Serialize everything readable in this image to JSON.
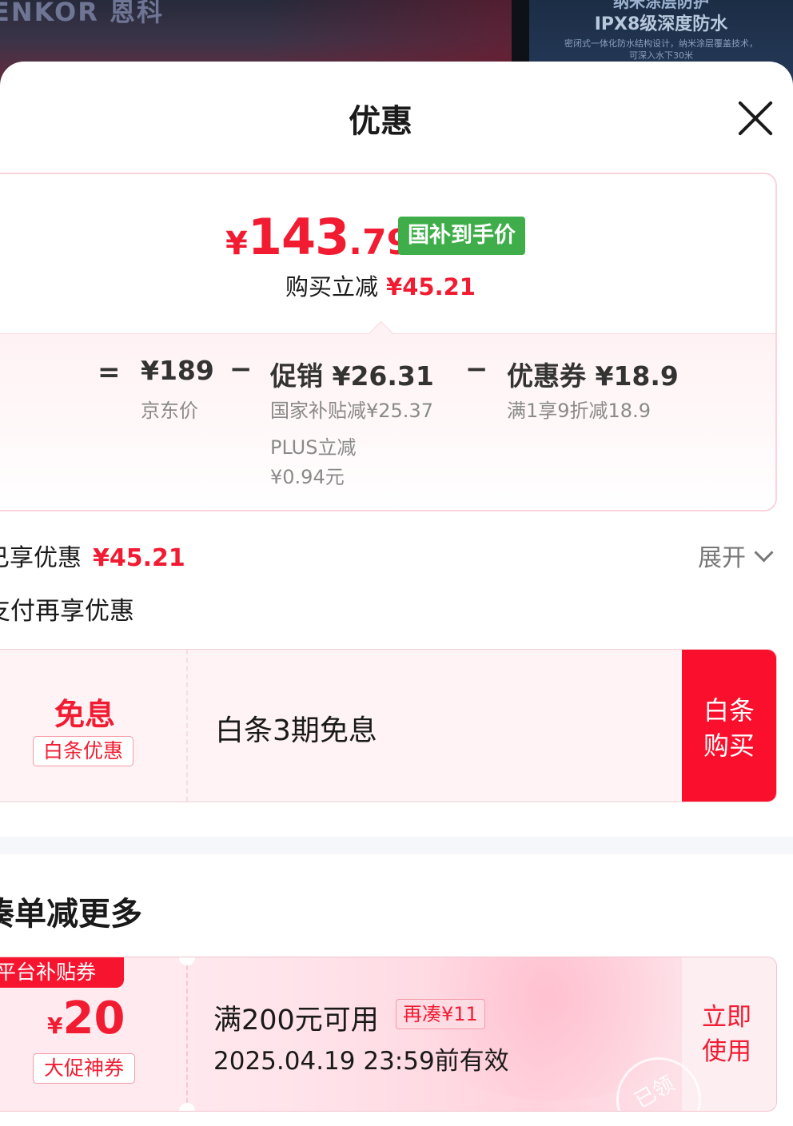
{
  "banner": {
    "brand": "ENKOR 恩科",
    "feature_line1": "纳米涂层防护",
    "feature_line2": "IPX8级深度防水",
    "feature_desc": "密闭式一体化防水结构设计，纳米涂层覆盖技术，可深入水下30米"
  },
  "sheet": {
    "title": "优惠",
    "close_icon": "close-icon"
  },
  "price_card": {
    "final_price_symbol": "¥",
    "final_price_int": "143",
    "final_price_dec": ".79",
    "final_price_tag": "国补到手价",
    "instant_label": "购买立减",
    "instant_amount": "¥45.21",
    "breakdown": {
      "eq_sign": "=",
      "minus_sign": "−",
      "base_price": "¥189",
      "base_label": "京东价",
      "promo_main": "促销 ¥26.31",
      "promo_sub1": "国家补贴减¥25.37",
      "promo_sub2": "PLUS立减",
      "promo_sub3": "¥0.94元",
      "coupon_main": "优惠券 ¥18.9",
      "coupon_sub": "满1享9折减18.9"
    }
  },
  "discount_summary": {
    "enjoyed_label": "已享优惠",
    "enjoyed_amount": "¥45.21",
    "expand_label": "展开",
    "pay_more_label": "支付再享优惠"
  },
  "baitiao": {
    "big_label": "免息",
    "badge": "白条优惠",
    "description": "白条3期免息",
    "button_line1": "白条",
    "button_line2": "购买"
  },
  "more_section": {
    "title": "凑单减更多"
  },
  "coupon": {
    "ribbon": "平台补贴券",
    "symbol": "¥",
    "value": "20",
    "badge": "大促神券",
    "condition": "满200元可用",
    "extra": "再凑¥11",
    "validity": "2025.04.19 23:59前有效",
    "button_line1": "立即",
    "button_line2": "使用",
    "stamp": "已领"
  },
  "colors": {
    "accent_red": "#f21c32",
    "tag_green": "#3fae4a",
    "button_red": "#fa0f2c"
  }
}
